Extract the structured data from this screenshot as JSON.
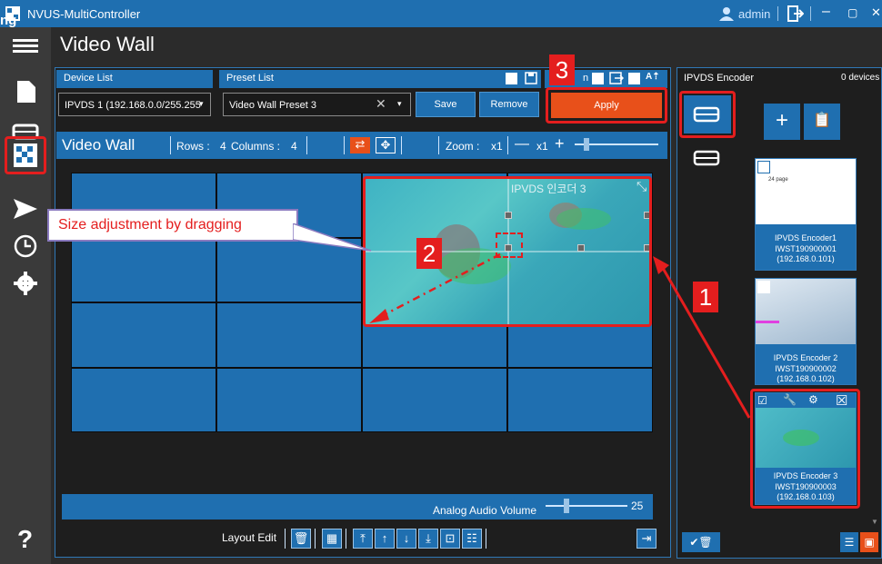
{
  "titlebar": {
    "app_title": "NVUS-MultiController",
    "user_label": "admin",
    "minimize": "–",
    "maximize": "▢",
    "close": "✕"
  },
  "header_fragment": "ng",
  "page_title": "Video Wall",
  "device_list": {
    "header": "Device List",
    "selected": "IPVDS 1 (192.168.0.0/255.255"
  },
  "preset_list": {
    "header": "Preset List",
    "selected": "Video Wall Preset 3",
    "save_label": "Save",
    "remove_label": "Remove",
    "apply_label": "Apply",
    "partial_text": "n"
  },
  "video_wall": {
    "title": "Video Wall",
    "rows_label": "Rows :",
    "rows_value": "4",
    "columns_label": "Columns :",
    "columns_value": "4",
    "zoom_label": "Zoom :",
    "zoom_value": "x1",
    "zoom_minus": "—",
    "zoom_value2": "x1",
    "zoom_plus": "+"
  },
  "overlay": {
    "label": "IPVDS 인코더 3"
  },
  "annotation": {
    "size_tip": "Size adjustment by dragging",
    "num1": "1",
    "num2": "2",
    "num3": "3"
  },
  "audio": {
    "label": "Analog Audio Volume",
    "value": "25",
    "level_fraction": 0.5
  },
  "layout_edit": {
    "label": "Layout Edit"
  },
  "encoder_panel": {
    "header": "IPVDS Encoder",
    "device_count": "0 devices",
    "encoders": [
      {
        "name": "IPVDS Encoder1",
        "serial": "IWST190900001",
        "ip": "(192.168.0.101)",
        "thumb_text": "24 page"
      },
      {
        "name": "IPVDS Encoder 2",
        "serial": "IWST190900002",
        "ip": "(192.168.0.102)"
      },
      {
        "name": "IPVDS Encoder 3",
        "serial": "IWST190900003",
        "ip": "(192.168.0.103)"
      }
    ]
  },
  "help_label": "?",
  "colors": {
    "titlebar": "#1f6fb0",
    "accent": "#1f6fb0",
    "apply": "#e8501a",
    "highlight": "#e41e1e"
  }
}
